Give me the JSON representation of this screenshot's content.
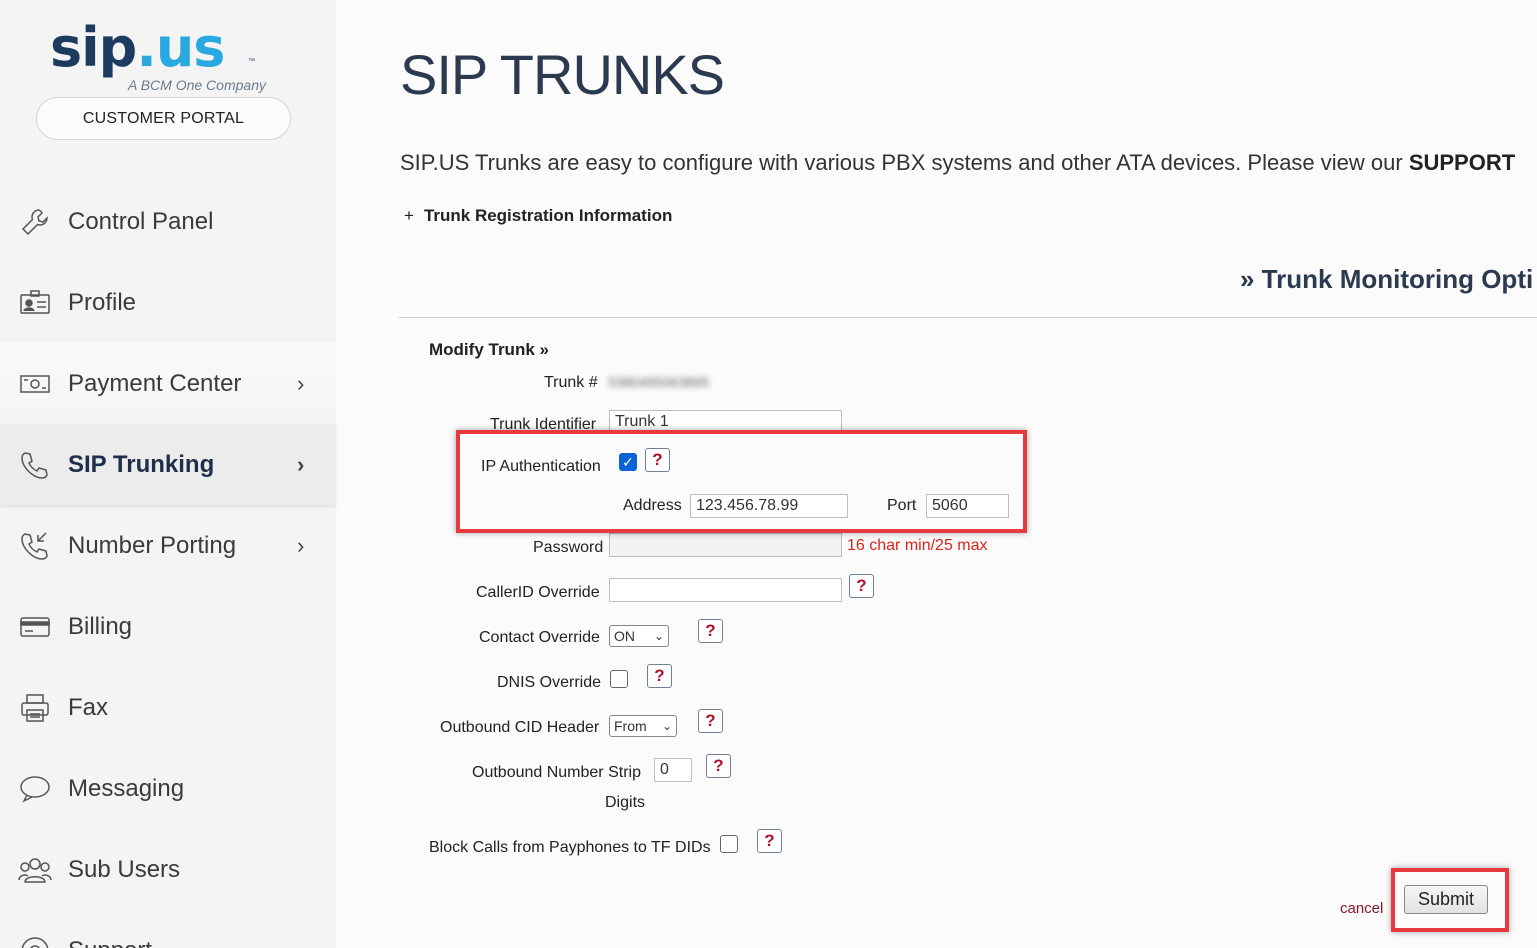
{
  "brand": {
    "logo_main": "sip",
    "logo_dot": ".",
    "logo_us": "us",
    "logo_tm": "™",
    "tagline": "A BCM One Company",
    "portal_label": "CUSTOMER PORTAL"
  },
  "sidebar": {
    "items": [
      {
        "label": "Control Panel",
        "icon": "wrench-icon",
        "chevron": ""
      },
      {
        "label": "Profile",
        "icon": "id-card-icon",
        "chevron": ""
      },
      {
        "label": "Payment Center",
        "icon": "money-icon",
        "chevron": "›"
      },
      {
        "label": "SIP Trunking",
        "icon": "phone-icon",
        "chevron": "›"
      },
      {
        "label": "Number Porting",
        "icon": "phone-incoming-icon",
        "chevron": "›"
      },
      {
        "label": "Billing",
        "icon": "credit-card-icon",
        "chevron": ""
      },
      {
        "label": "Fax",
        "icon": "printer-icon",
        "chevron": ""
      },
      {
        "label": "Messaging",
        "icon": "chat-bubble-icon",
        "chevron": ""
      },
      {
        "label": "Sub Users",
        "icon": "users-icon",
        "chevron": ""
      },
      {
        "label": "Support",
        "icon": "support-icon",
        "chevron": ""
      }
    ]
  },
  "main": {
    "title": "SIP TRUNKS",
    "intro_text": "SIP.US Trunks are easy to configure with various PBX systems and other ATA devices. Please view our ",
    "intro_bold": "SUPPORT",
    "reg_info_plus": "+",
    "reg_info_label": "Trunk Registration Information",
    "monitoring_label": "» Trunk Monitoring Opti"
  },
  "form": {
    "title": "Modify Trunk »",
    "trunk_number_label": "Trunk #",
    "trunk_number_value": "5380495063895",
    "trunk_identifier_label": "Trunk Identifier",
    "trunk_identifier_value": "Trunk 1",
    "ip_auth_label": "IP Authentication",
    "ip_auth_checked": "✓",
    "address_label": "Address",
    "address_value": "123.456.78.99",
    "port_label": "Port",
    "port_value": "5060",
    "password_label": "Password",
    "password_hint": "16 char min/25 max",
    "callerid_label": "CallerID Override",
    "contact_override_label": "Contact Override",
    "contact_override_value": "ON",
    "dnis_label": "DNIS Override",
    "outbound_cid_label": "Outbound CID Header",
    "outbound_cid_value": "From",
    "strip_label": "Outbound Number Strip",
    "strip_label2": "Digits",
    "strip_value": "0",
    "payphone_label": "Block Calls from Payphones to TF DIDs",
    "help_glyph": "?",
    "cancel_label": "cancel",
    "submit_label": "Submit"
  }
}
